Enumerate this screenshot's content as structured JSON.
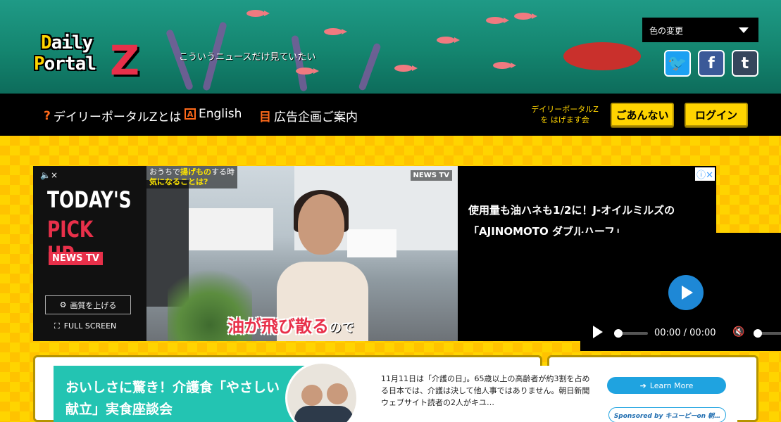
{
  "header": {
    "logo_line1": "Daily",
    "logo_line2": "Portal",
    "logo_z": "Z",
    "tagline": "こういうニュースだけ見ていたい",
    "color_select": "色の変更",
    "social": [
      "t",
      "f",
      "t"
    ]
  },
  "nav": {
    "items": [
      {
        "icon": "?",
        "label": "デイリーポータルZとは"
      },
      {
        "icon": "A",
        "label": "English"
      },
      {
        "icon": "目",
        "label": "広告企画ご案内"
      }
    ],
    "support": "デイリーポータルZ\nを はげます会",
    "guide_button": "ごあんない",
    "login_button": "ログイン"
  },
  "video_ad": {
    "mute": "🔈×",
    "today": "TODAY'S",
    "pickup": "PICK UP",
    "brand": "NEWS TV",
    "quality_button": "画質を上げる",
    "fullscreen": "FULL SCREEN",
    "caption_pre": "おうちで",
    "caption_hl1": "揚げもの",
    "caption_mid": "する時",
    "caption_hl2": "気になることは?",
    "channel": "NEWS TV",
    "subtitle_main": "油が飛び散る",
    "subtitle_end": "ので",
    "headline": "使用量も油ハネも1/2に！J-オイルミルズの「AJINOMOTO ダブルハーフ」",
    "ad_info": "ⓘ✕"
  },
  "player": {
    "time": "00:00 / 00:00"
  },
  "bottom_ad": {
    "title": "おいしさに驚き！介護食「やさしい献立」実食座談会",
    "body": "11月11日は「介護の日」。65歳以上の高齢者が約3割を占める日本では、介護は決して他人事ではありません。朝日新聞ウェブサイト読者の2人がキユ…",
    "learn_more": "Learn More",
    "sponsored": "Sponsored by キユーピーon 朝…"
  }
}
